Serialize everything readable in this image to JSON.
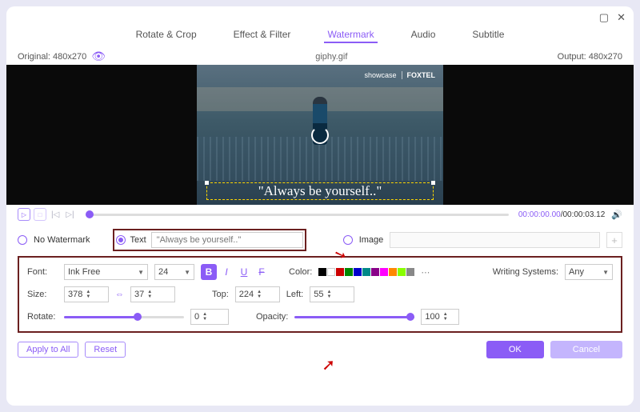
{
  "titlebar": {
    "minimize": "▢",
    "close": "✕"
  },
  "tabs": {
    "items": [
      "Rotate & Crop",
      "Effect & Filter",
      "Watermark",
      "Audio",
      "Subtitle"
    ],
    "active": 2
  },
  "info": {
    "original_label": "Original: 480x270",
    "filename": "giphy.gif",
    "output_label": "Output: 480x270"
  },
  "preview": {
    "brand_l": "showcase",
    "brand_r": "FOXTEL",
    "caption": "\"Always be yourself..\""
  },
  "player": {
    "time_cur": "00:00:00.00",
    "time_dur": "/00:00:03.12"
  },
  "watermark": {
    "no_label": "No Watermark",
    "text_label": "Text",
    "text_value": "\"Always be yourself..\"",
    "image_label": "Image"
  },
  "panel": {
    "font_label": "Font:",
    "font_value": "Ink Free",
    "font_size": "24",
    "color_label": "Color:",
    "swatches": [
      "#000",
      "#fff",
      "#c00",
      "#080",
      "#00c",
      "#088",
      "#808",
      "#f0f",
      "#f80",
      "#8f0",
      "#888"
    ],
    "ws_label": "Writing Systems:",
    "ws_value": "Any",
    "size_label": "Size:",
    "size_w": "378",
    "size_h": "37",
    "top_label": "Top:",
    "top_v": "224",
    "left_label": "Left:",
    "left_v": "55",
    "rotate_label": "Rotate:",
    "rotate_v": "0",
    "opacity_label": "Opacity:",
    "opacity_v": "100"
  },
  "footer": {
    "apply": "Apply to All",
    "reset": "Reset",
    "ok": "OK",
    "cancel": "Cancel"
  }
}
